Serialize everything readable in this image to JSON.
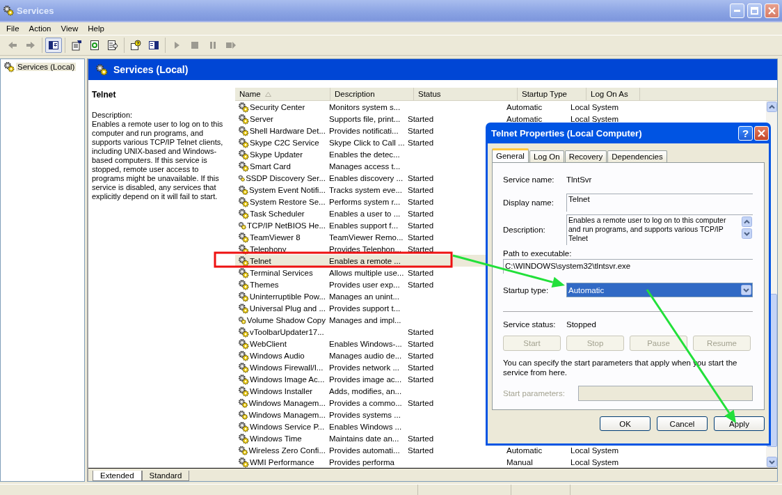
{
  "window": {
    "title": "Services"
  },
  "menu": [
    "File",
    "Action",
    "View",
    "Help"
  ],
  "toolbar_groups": [
    {
      "buttons": [
        {
          "kind": "back",
          "disabled": true,
          "pressed": false
        },
        {
          "kind": "forward",
          "disabled": true,
          "pressed": false
        }
      ]
    },
    {
      "buttons": [
        {
          "kind": "tree",
          "disabled": false,
          "pressed": true
        }
      ]
    },
    {
      "buttons": [
        {
          "kind": "properties",
          "disabled": false,
          "pressed": false
        },
        {
          "kind": "refresh",
          "disabled": false,
          "pressed": false
        },
        {
          "kind": "export",
          "disabled": false,
          "pressed": false
        }
      ]
    },
    {
      "buttons": [
        {
          "kind": "help",
          "disabled": false,
          "pressed": false
        },
        {
          "kind": "console",
          "disabled": false,
          "pressed": false
        }
      ]
    },
    {
      "buttons": [
        {
          "kind": "play",
          "disabled": true,
          "pressed": false
        },
        {
          "kind": "stop",
          "disabled": true,
          "pressed": false
        },
        {
          "kind": "pause",
          "disabled": true,
          "pressed": false
        },
        {
          "kind": "restart",
          "disabled": true,
          "pressed": false
        }
      ]
    }
  ],
  "tree": {
    "items": [
      {
        "label": "Services (Local)",
        "selected": true
      }
    ]
  },
  "header": {
    "title": "Services (Local)"
  },
  "details": {
    "title": "Telnet",
    "label": "Description:",
    "text": "Enables a remote user to log on to this computer and run programs, and supports various TCP/IP Telnet clients, including UNIX-based and Windows-based computers. If this service is stopped, remote user access to programs might be unavailable. If this service is disabled, any services that explicitly depend on it will fail to start."
  },
  "table": {
    "columns": [
      {
        "label": "Name",
        "sorted": true
      },
      {
        "label": "Description",
        "sorted": false
      },
      {
        "label": "Status",
        "sorted": false
      },
      {
        "label": "Startup Type",
        "sorted": false
      },
      {
        "label": "Log On As",
        "sorted": false
      }
    ],
    "rows": [
      {
        "name": "Security Center",
        "description": "Monitors system s...",
        "startup_type": "Automatic",
        "log_on_as": "Local System",
        "selected": false
      },
      {
        "name": "Server",
        "description": "Supports file, print...",
        "status": "Started",
        "startup_type": "Automatic",
        "log_on_as": "Local System",
        "selected": false
      },
      {
        "name": "Shell Hardware Det...",
        "description": "Provides notificati...",
        "status": "Started",
        "selected": false
      },
      {
        "name": "Skype C2C Service",
        "description": "Skype Click to Call ...",
        "status": "Started",
        "selected": false
      },
      {
        "name": "Skype Updater",
        "description": "Enables the detec...",
        "selected": false
      },
      {
        "name": "Smart Card",
        "description": "Manages access t...",
        "selected": false
      },
      {
        "name": "SSDP Discovery Ser...",
        "description": "Enables discovery ...",
        "status": "Started",
        "selected": false
      },
      {
        "name": "System Event Notifi...",
        "description": "Tracks system eve...",
        "status": "Started",
        "selected": false
      },
      {
        "name": "System Restore Se...",
        "description": "Performs system r...",
        "status": "Started",
        "selected": false
      },
      {
        "name": "Task Scheduler",
        "description": "Enables a user to ...",
        "status": "Started",
        "selected": false
      },
      {
        "name": "TCP/IP NetBIOS He...",
        "description": "Enables support f...",
        "status": "Started",
        "selected": false
      },
      {
        "name": "TeamViewer 8",
        "description": "TeamViewer Remo...",
        "status": "Started",
        "selected": false
      },
      {
        "name": "Telephony",
        "description": "Provides Telephon...",
        "status": "Started",
        "selected": false
      },
      {
        "name": "Telnet",
        "description": "Enables a remote ...",
        "selected": true
      },
      {
        "name": "Terminal Services",
        "description": "Allows multiple use...",
        "status": "Started",
        "selected": false
      },
      {
        "name": "Themes",
        "description": "Provides user exp...",
        "status": "Started",
        "selected": false
      },
      {
        "name": "Uninterruptible Pow...",
        "description": "Manages an unint...",
        "selected": false
      },
      {
        "name": "Universal Plug and ...",
        "description": "Provides support t...",
        "selected": false
      },
      {
        "name": "Volume Shadow Copy",
        "description": "Manages and impl...",
        "selected": false
      },
      {
        "name": "vToolbarUpdater17...",
        "status": "Started",
        "selected": false
      },
      {
        "name": "WebClient",
        "description": "Enables Windows-...",
        "status": "Started",
        "selected": false
      },
      {
        "name": "Windows Audio",
        "description": "Manages audio de...",
        "status": "Started",
        "selected": false
      },
      {
        "name": "Windows Firewall/I...",
        "description": "Provides network ...",
        "status": "Started",
        "selected": false
      },
      {
        "name": "Windows Image Ac...",
        "description": "Provides image ac...",
        "status": "Started",
        "selected": false
      },
      {
        "name": "Windows Installer",
        "description": "Adds, modifies, an...",
        "selected": false
      },
      {
        "name": "Windows Managem...",
        "description": "Provides a commo...",
        "status": "Started",
        "selected": false
      },
      {
        "name": "Windows Managem...",
        "description": "Provides systems ...",
        "selected": false
      },
      {
        "name": "Windows Service P...",
        "description": "Enables Windows ...",
        "selected": false
      },
      {
        "name": "Windows Time",
        "description": "Maintains date an...",
        "status": "Started",
        "selected": false
      },
      {
        "name": "Wireless Zero Confi...",
        "description": "Provides automati...",
        "status": "Started",
        "startup_type": "Automatic",
        "log_on_as": "Local System",
        "selected": false
      },
      {
        "name": "WMI Performance",
        "description": "Provides performa",
        "startup_type": "Manual",
        "log_on_as": "Local System",
        "selected": false
      }
    ]
  },
  "view_tabs": [
    {
      "label": "Extended",
      "selected": true
    },
    {
      "label": "Standard",
      "selected": false
    }
  ],
  "dialog": {
    "title": "Telnet Properties (Local Computer)",
    "help_button": "?",
    "tabs": [
      {
        "label": "General",
        "selected": true
      },
      {
        "label": "Log On",
        "selected": false
      },
      {
        "label": "Recovery",
        "selected": false
      },
      {
        "label": "Dependencies",
        "selected": false
      }
    ],
    "service_name": {
      "label": "Service name:",
      "value": "TlntSvr"
    },
    "display_name": {
      "label": "Display name:",
      "value": "Telnet"
    },
    "description": {
      "label": "Description:",
      "value": "Enables a remote user to log on to this computer and run programs, and supports various TCP/IP Telnet"
    },
    "path": {
      "label": "Path to executable:",
      "value": "C:\\WINDOWS\\system32\\tlntsvr.exe"
    },
    "startup_type": {
      "label": "Startup type:",
      "value": "Automatic",
      "focused": true
    },
    "service_status": {
      "label": "Service status:",
      "value": "Stopped"
    },
    "control_buttons": [
      {
        "label": "Start",
        "disabled": true
      },
      {
        "label": "Stop",
        "disabled": true
      },
      {
        "label": "Pause",
        "disabled": true
      },
      {
        "label": "Resume",
        "disabled": true
      }
    ],
    "hint": "You can specify the start parameters that apply when you start the service from here.",
    "start_parameters": {
      "label": "Start parameters:",
      "disabled": true
    },
    "buttons": [
      {
        "label": "OK",
        "disabled": false
      },
      {
        "label": "Cancel",
        "disabled": false
      },
      {
        "label": "Apply",
        "disabled": false
      }
    ]
  },
  "annotations": [
    {
      "kind": "highlight_box"
    },
    {
      "kind": "arrow"
    },
    {
      "kind": "arrow"
    }
  ]
}
